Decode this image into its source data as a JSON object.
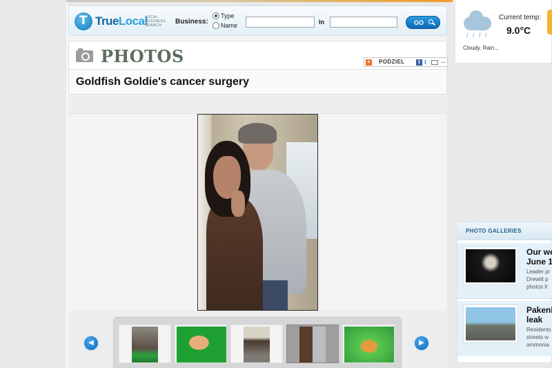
{
  "search": {
    "brand_part1": "True",
    "brand_part2": "Local",
    "tagline": "LOCAL BUSINESS SEARCH",
    "business_label": "Business:",
    "radio_type": "Type",
    "radio_name": "Name",
    "business_value": "",
    "in_label": "In",
    "location_value": "",
    "go_label": "GO"
  },
  "photos": {
    "section_title": "PHOTOS",
    "share_label": "PODZIEL",
    "share_fb": "f",
    "share_tw": "t",
    "share_more": "..."
  },
  "article": {
    "title": "Goldfish Goldie's cancer surgery"
  },
  "thumbnails": {
    "prev_label": "◀",
    "next_label": "▶",
    "items": [
      {
        "selected": false
      },
      {
        "selected": false
      },
      {
        "selected": false
      },
      {
        "selected": true
      },
      {
        "selected": false
      }
    ]
  },
  "weather": {
    "icon": "rain-cloud-icon",
    "rain_glyphs": "/ / / /",
    "current_label": "Current temp:",
    "temp": "9.0°C",
    "description": "Cloudy. Rain..."
  },
  "galleries": {
    "header": "PHOTO GALLERIES",
    "items": [
      {
        "title_l1": "Our we",
        "title_l2": "June 1",
        "text_l1": "Leader pi",
        "text_l2": "Drewitt p",
        "text_l3": "photos fr"
      },
      {
        "title_l1": "Pakenh",
        "title_l2": "leak",
        "text_l1": "Residents",
        "text_l2": "streets w",
        "text_l3": "ammonia"
      }
    ]
  },
  "colors": {
    "accent_blue": "#0e66b7",
    "photos_title": "#5b6e5e",
    "gallery_head": "#1e5f8c"
  }
}
